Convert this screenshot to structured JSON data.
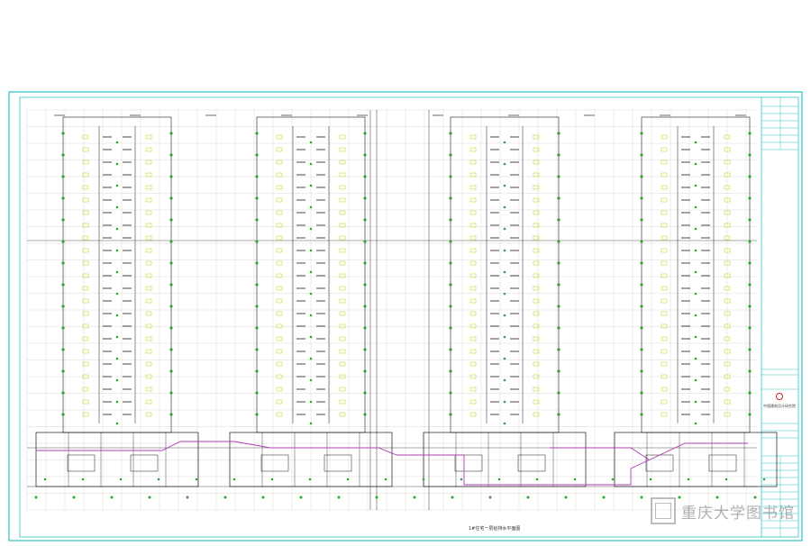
{
  "drawing": {
    "sheet_title": "1#住宅一层给排水平面图",
    "company_label": "中国建筑设计研究院",
    "colors": {
      "frame": "#2ec4c4",
      "grid": "#c8c8c8",
      "wall": "#1a1a1a",
      "pipe": "#2fa82f",
      "fixture": "#c8d830",
      "drain": "#b040b0",
      "text": "#333333",
      "logo": "#cc2222"
    },
    "icons": [
      "logo-seal-icon",
      "library-logo-icon"
    ]
  },
  "watermark": {
    "text": "重庆大学图书馆"
  }
}
